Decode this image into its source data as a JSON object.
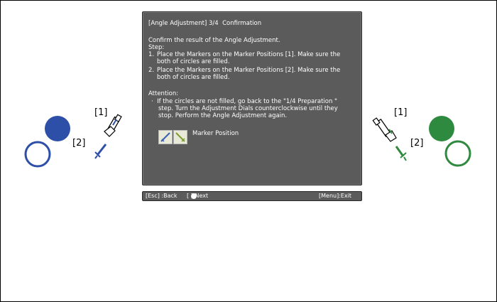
{
  "dialog": {
    "title": "[Angle Adjustment] 3/4  Confirmation",
    "intro": "Confirm the result of the Angle Adjustment.",
    "step_heading": "Step:",
    "steps": [
      {
        "number": "1.",
        "line1": "Place the Markers on the Marker Positions [1]. Make sure the",
        "line2": "both of circles are filled."
      },
      {
        "number": "2.",
        "line1": "Place the Markers on the Marker Positions [2]. Make sure the",
        "line2": "both of circles are filled."
      }
    ],
    "attention_heading": "Attention:",
    "attention_lines": [
      "·  If the circles are not filled, go back to the \"1/4 Preparation \"",
      "step. Turn the Adjustment Dials counterclockwise until they",
      "stop. Perform the Angle Adjustment again."
    ],
    "marker_position_label": "Marker Position"
  },
  "footer": {
    "back": "[Esc] :Back",
    "next": "[ ]:Next",
    "exit": "[Menu]:Exit"
  },
  "left_diagram": {
    "label_1": "[1]",
    "label_2": "[2]",
    "color": "#2e4fa8"
  },
  "right_diagram": {
    "label_1": "[1]",
    "label_2": "[2]",
    "color": "#2e8a3e"
  }
}
